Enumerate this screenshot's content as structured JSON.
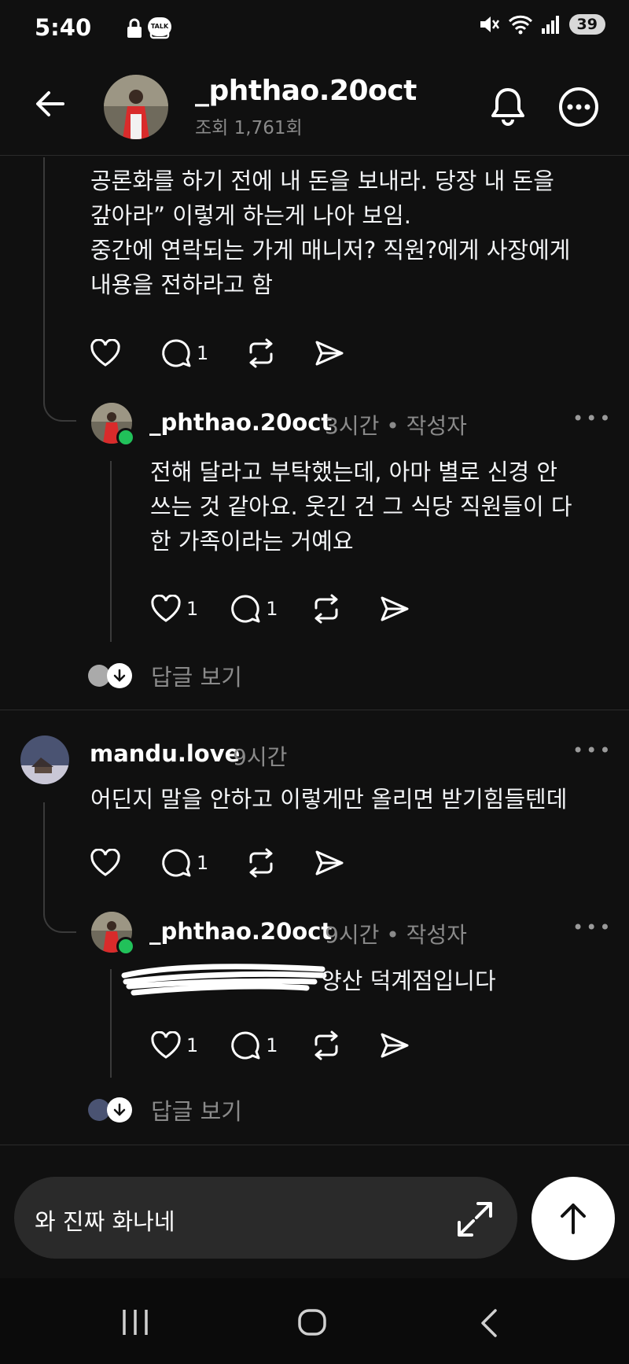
{
  "status_bar": {
    "time": "5:40",
    "battery": "39",
    "talk_label": "TALK"
  },
  "header": {
    "username": "_phthao.20oct",
    "views": "조회 1,761회"
  },
  "post_tail": {
    "lines": [
      "공론화를 하기 전에 내 돈을 보내라. 당장 내 돈을",
      "갚아라” 이렇게 하는게 나아 보임.",
      "중간에  연락되는 가게 매니저? 직원?에게 사장에게",
      "내용을 전하라고 함"
    ],
    "reply_count": "1"
  },
  "reply1": {
    "username": "_phthao.20oct",
    "time": "3시간",
    "author_tag": "• 작성자",
    "lines": [
      "전해 달라고 부탁했는데, 아마 별로 신경 안",
      "쓰는 것 같아요. 웃긴 건 그 식당 직원들이 다",
      "한 가족이라는 거예요"
    ],
    "like_count": "1",
    "reply_count": "1"
  },
  "view_replies_1": "답글 보기",
  "comment2": {
    "username": "mandu.love",
    "time": "9시간",
    "text": "어딘지 말을 안하고 이렇게만 올리면 받기힘들텐데",
    "reply_count": "1"
  },
  "reply2": {
    "username": "_phthao.20oct",
    "time": "9시간",
    "author_tag": "• 작성자",
    "text_visible": "양산 덕계점입니다",
    "like_count": "1",
    "reply_count": "1"
  },
  "view_replies_2": "답글 보기",
  "composer": {
    "text": "와 진짜 화나네"
  },
  "colors": {
    "background": "#101010",
    "online": "#21c15a",
    "muted": "#8a8a8a"
  }
}
